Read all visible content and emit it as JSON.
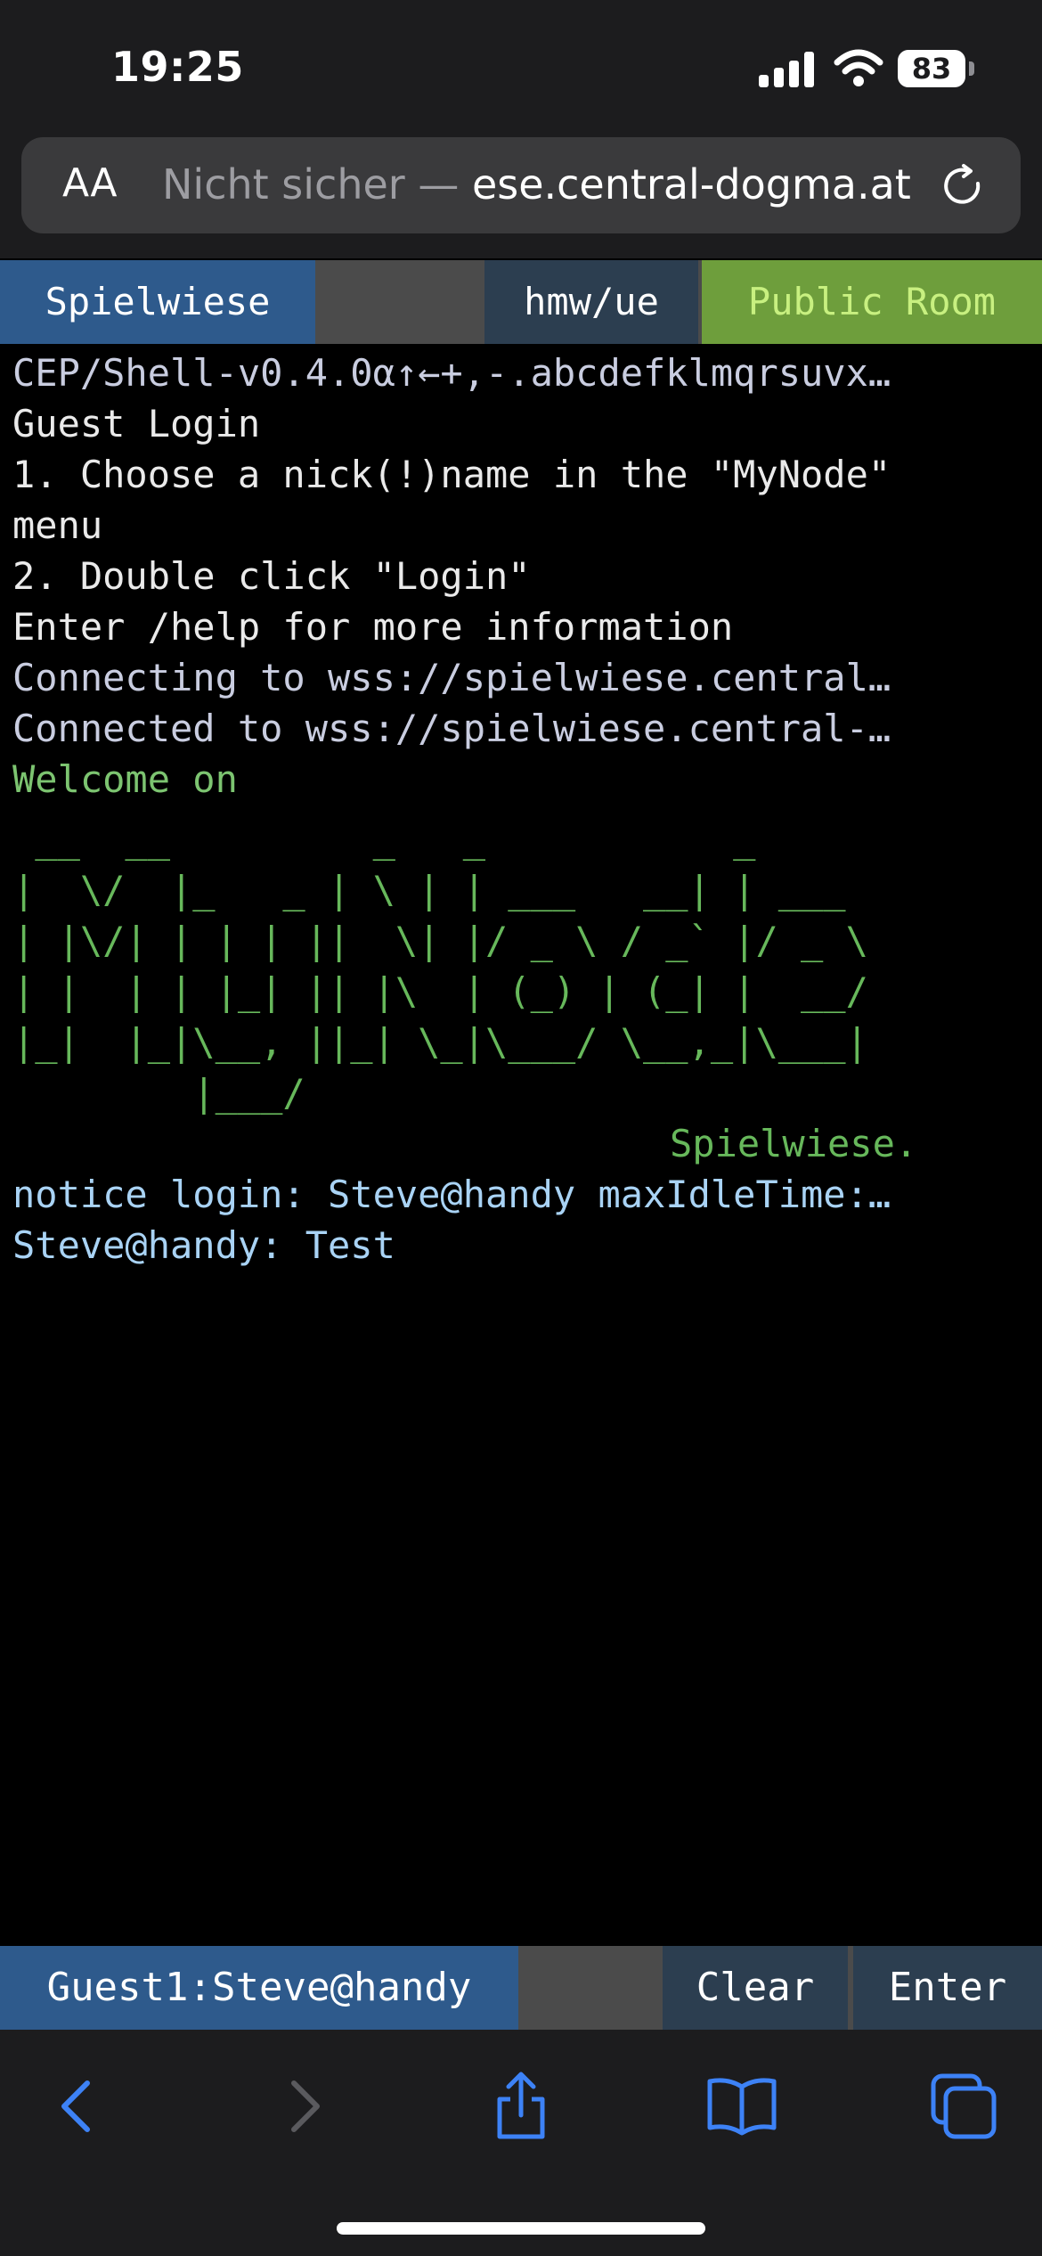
{
  "status_bar": {
    "time": "19:25",
    "battery": "83"
  },
  "address_bar": {
    "text_size_label": "AA",
    "security_label": "Nicht sicher — ",
    "host": "ese.central-dogma.at"
  },
  "tabs": {
    "node": "Spielwiese",
    "path": "hmw/ue",
    "room": "Public Room"
  },
  "terminal": {
    "lines": [
      "CEP/Shell-v0.4.0α↑←+,-.abcdefklmqrsuvx…",
      "Guest Login",
      "1. Choose a nick(!)name in the \"MyNode\"",
      "menu",
      "2. Double click \"Login\"",
      "Enter /help for more information",
      "Connecting to wss://spielwiese.central…",
      "Connected to wss://spielwiese.central-…",
      "Welcome on"
    ],
    "ascii_art": " __  __         _   _           _\n|  \\/  |_   _ | \\ | | ___   __| | ___\n| |\\/| | | | ||  \\| |/ _ \\ / _` |/ _ \\\n| |  | | |_| || |\\  | (_) | (_| |  __/\n|_|  |_|\\__, ||_| \\_|\\___/ \\__,_|\\___|\n        |___/",
    "ascii_subtitle": "Spielwiese.",
    "notice": "notice login: Steve@handy maxIdleTime:…",
    "message": "Steve@handy: Test"
  },
  "input_bar": {
    "user": "Guest1:Steve@handy",
    "clear": "Clear",
    "enter": "Enter"
  },
  "toolbar_icons": [
    "back-icon",
    "forward-icon",
    "share-icon",
    "bookmarks-icon",
    "tabs-icon"
  ],
  "colors": {
    "tab_blue": "#2e5a8c",
    "tab_dark": "#2c3e50",
    "tab_green": "#6e9e3c",
    "terminal_green": "#7cc470",
    "terminal_blue": "#a9d3f5",
    "ios_blue": "#3d82f6"
  }
}
